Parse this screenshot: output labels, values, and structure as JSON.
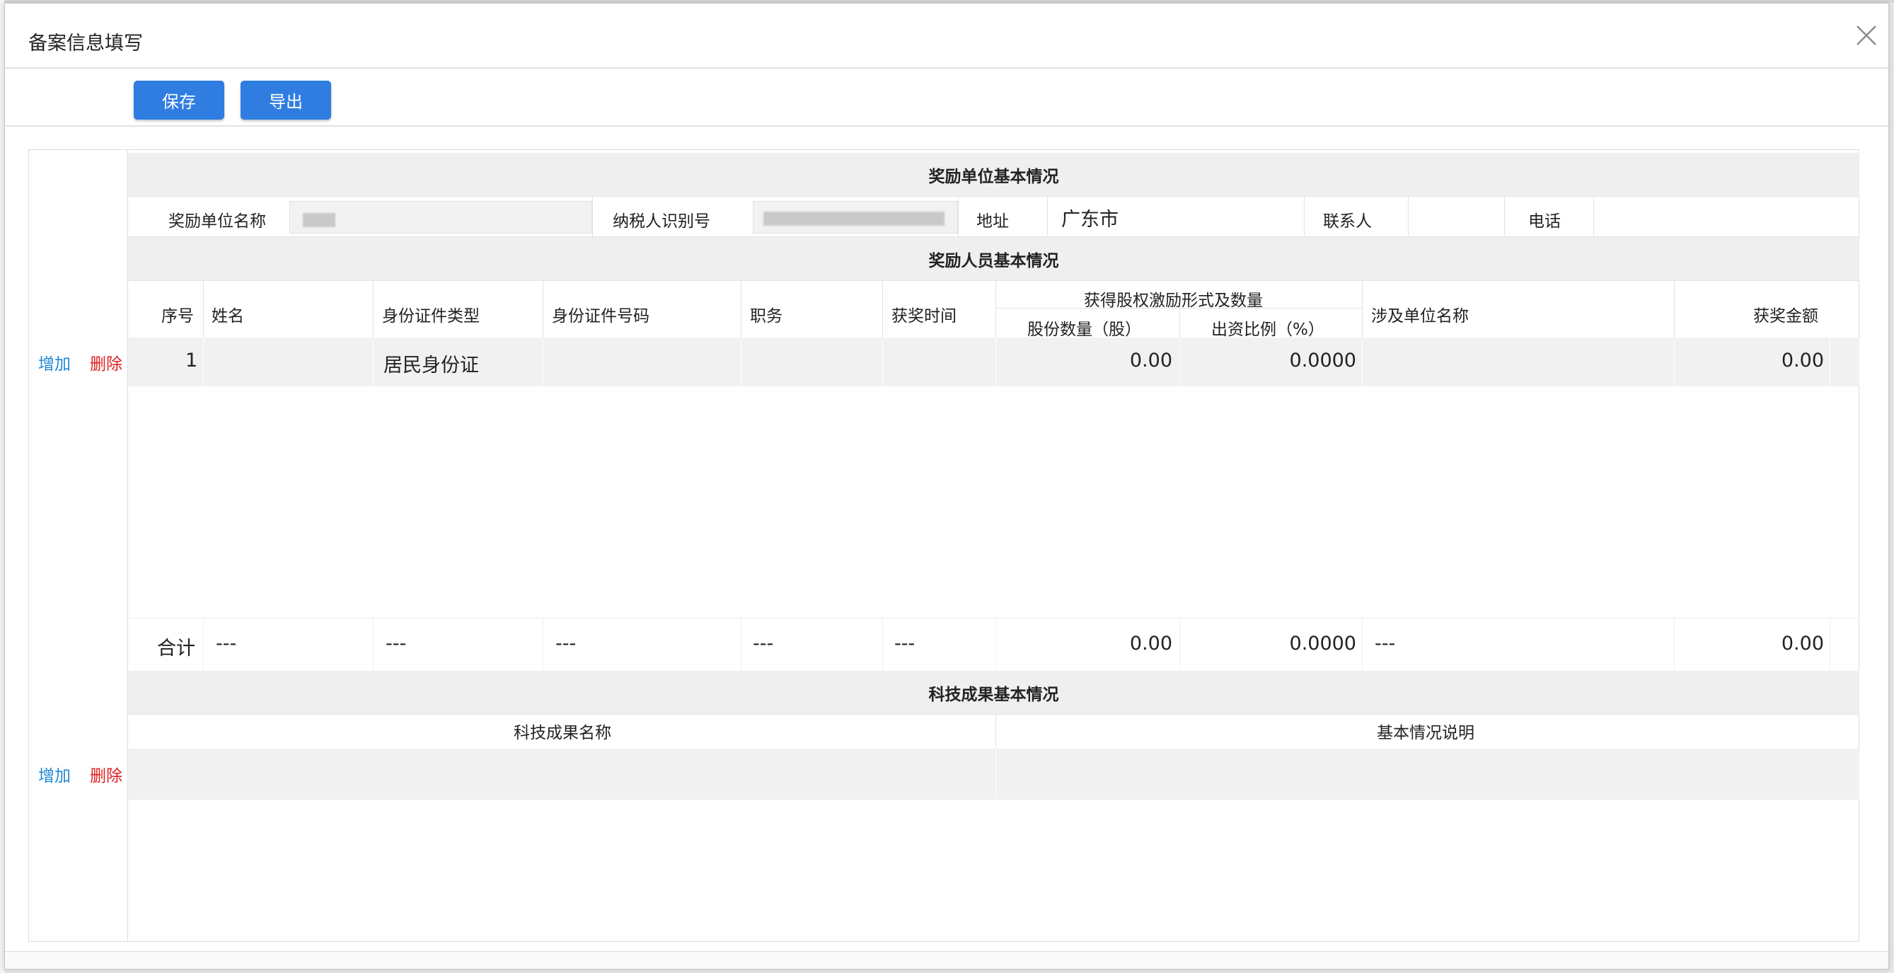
{
  "dialog": {
    "title": "备案信息填写"
  },
  "toolbar": {
    "save": "保存",
    "export": "导出"
  },
  "actions": {
    "add": "增加",
    "delete": "删除"
  },
  "unit_section": {
    "heading": "奖励单位基本情况",
    "name_label": "奖励单位名称",
    "taxid_label": "纳税人识别号",
    "address_label": "地址",
    "address_value": "广东市",
    "contact_label": "联系人",
    "phone_label": "电话"
  },
  "personnel_section": {
    "heading": "奖励人员基本情况",
    "columns": {
      "seq": "序号",
      "name": "姓名",
      "id_type": "身份证件类型",
      "id_number": "身份证件号码",
      "position": "职务",
      "award_time": "获奖时间",
      "equity_group": "获得股权激励形式及数量",
      "shares": "股份数量（股）",
      "ratio": "出资比例（%）",
      "org": "涉及单位名称",
      "amount": "获奖金额"
    },
    "rows": [
      {
        "seq": "1",
        "id_type": "居民身份证",
        "shares": "0.00",
        "ratio": "0.0000",
        "amount": "0.00"
      }
    ],
    "total": {
      "label": "合计",
      "name": "---",
      "id_type": "---",
      "id_number": "---",
      "position": "---",
      "award_time": "---",
      "shares": "0.00",
      "ratio": "0.0000",
      "org": "---",
      "amount": "0.00"
    }
  },
  "tech_section": {
    "heading": "科技成果基本情况",
    "col_name": "科技成果名称",
    "col_desc": "基本情况说明"
  }
}
